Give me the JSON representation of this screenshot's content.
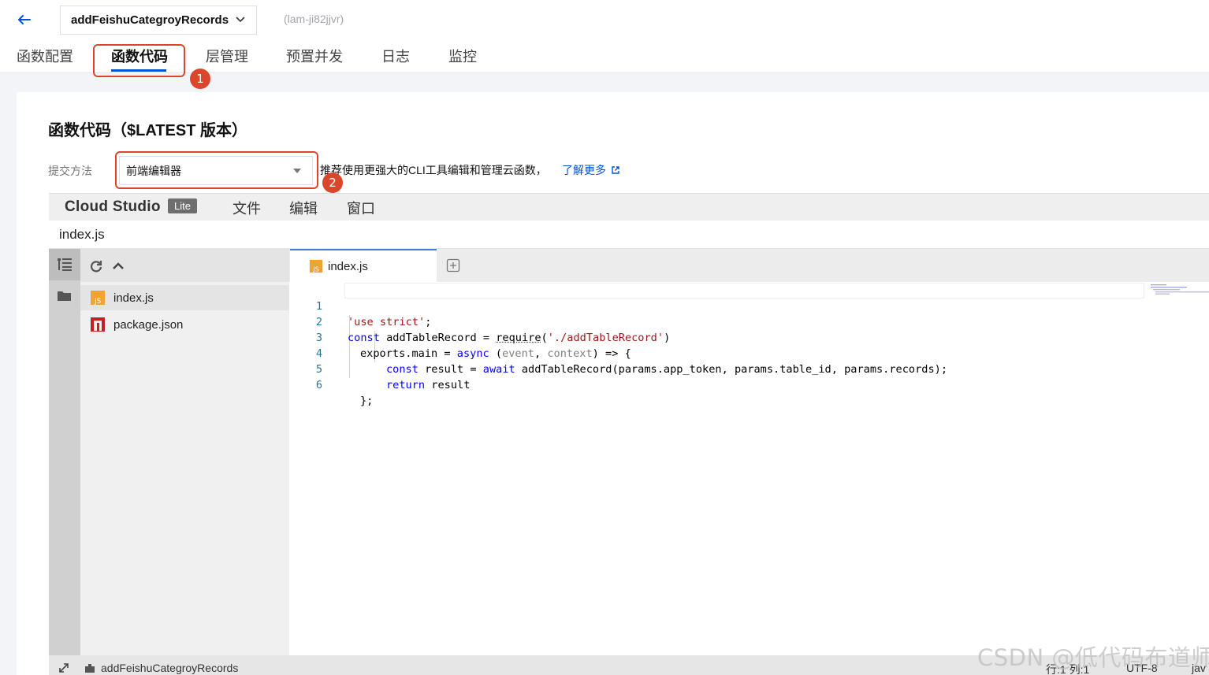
{
  "header": {
    "function_name": "addFeishuCategroyRecords",
    "function_id": "(lam-ji82jjvr)"
  },
  "tabs": [
    {
      "label": "函数配置"
    },
    {
      "label": "函数代码"
    },
    {
      "label": "层管理"
    },
    {
      "label": "预置并发"
    },
    {
      "label": "日志"
    },
    {
      "label": "监控"
    }
  ],
  "active_tab": "函数代码",
  "annotations": {
    "badge1": "1",
    "badge2": "2"
  },
  "main": {
    "title": "函数代码（$LATEST 版本）",
    "submit_label": "提交方法",
    "submit_value": "前端编辑器",
    "hint": "推荐使用更强大的CLI工具编辑和管理云函数，",
    "learn_more": "了解更多"
  },
  "ide": {
    "logo": "Cloud Studio",
    "badge": "Lite",
    "menu": [
      "文件",
      "编辑",
      "窗口"
    ],
    "path": "index.js",
    "files": [
      {
        "name": "index.js",
        "icon": "js-file-icon"
      },
      {
        "name": "package.json",
        "icon": "npm-file-icon"
      }
    ],
    "editor_tab": "index.js",
    "code": {
      "line_numbers": [
        "1",
        "2",
        "3",
        "4",
        "5",
        "6"
      ],
      "l1": {
        "s": "'use strict'",
        "p": ";"
      },
      "l2": {
        "k1": "const",
        "t1": " addTableRecord = ",
        "t2": "require",
        "t3": "(",
        "s": "'./addTableRecord'",
        "t4": ")"
      },
      "l3": {
        "t1": "exports.main = ",
        "k1": "async",
        "t2": " (",
        "p1": "event",
        "t3": ", ",
        "p2": "context",
        "t4": ") => {"
      },
      "l4": {
        "k1": "const",
        "t1": " result = ",
        "k2": "await",
        "t2": " addTableRecord(params.app_token, params.table_id, params.records);"
      },
      "l5": {
        "k1": "return",
        "t1": " result"
      },
      "l6": {
        "t1": "};"
      }
    },
    "status": {
      "project": "addFeishuCategroyRecords",
      "position": "行:1 列:1",
      "encoding": "UTF-8",
      "language": "jav"
    }
  },
  "watermark": "CSDN @低代码布道师",
  "colors": {
    "accent": "#0052d9",
    "annotation": "#d9462b",
    "keyword": "#0000ff",
    "string": "#a31515"
  }
}
